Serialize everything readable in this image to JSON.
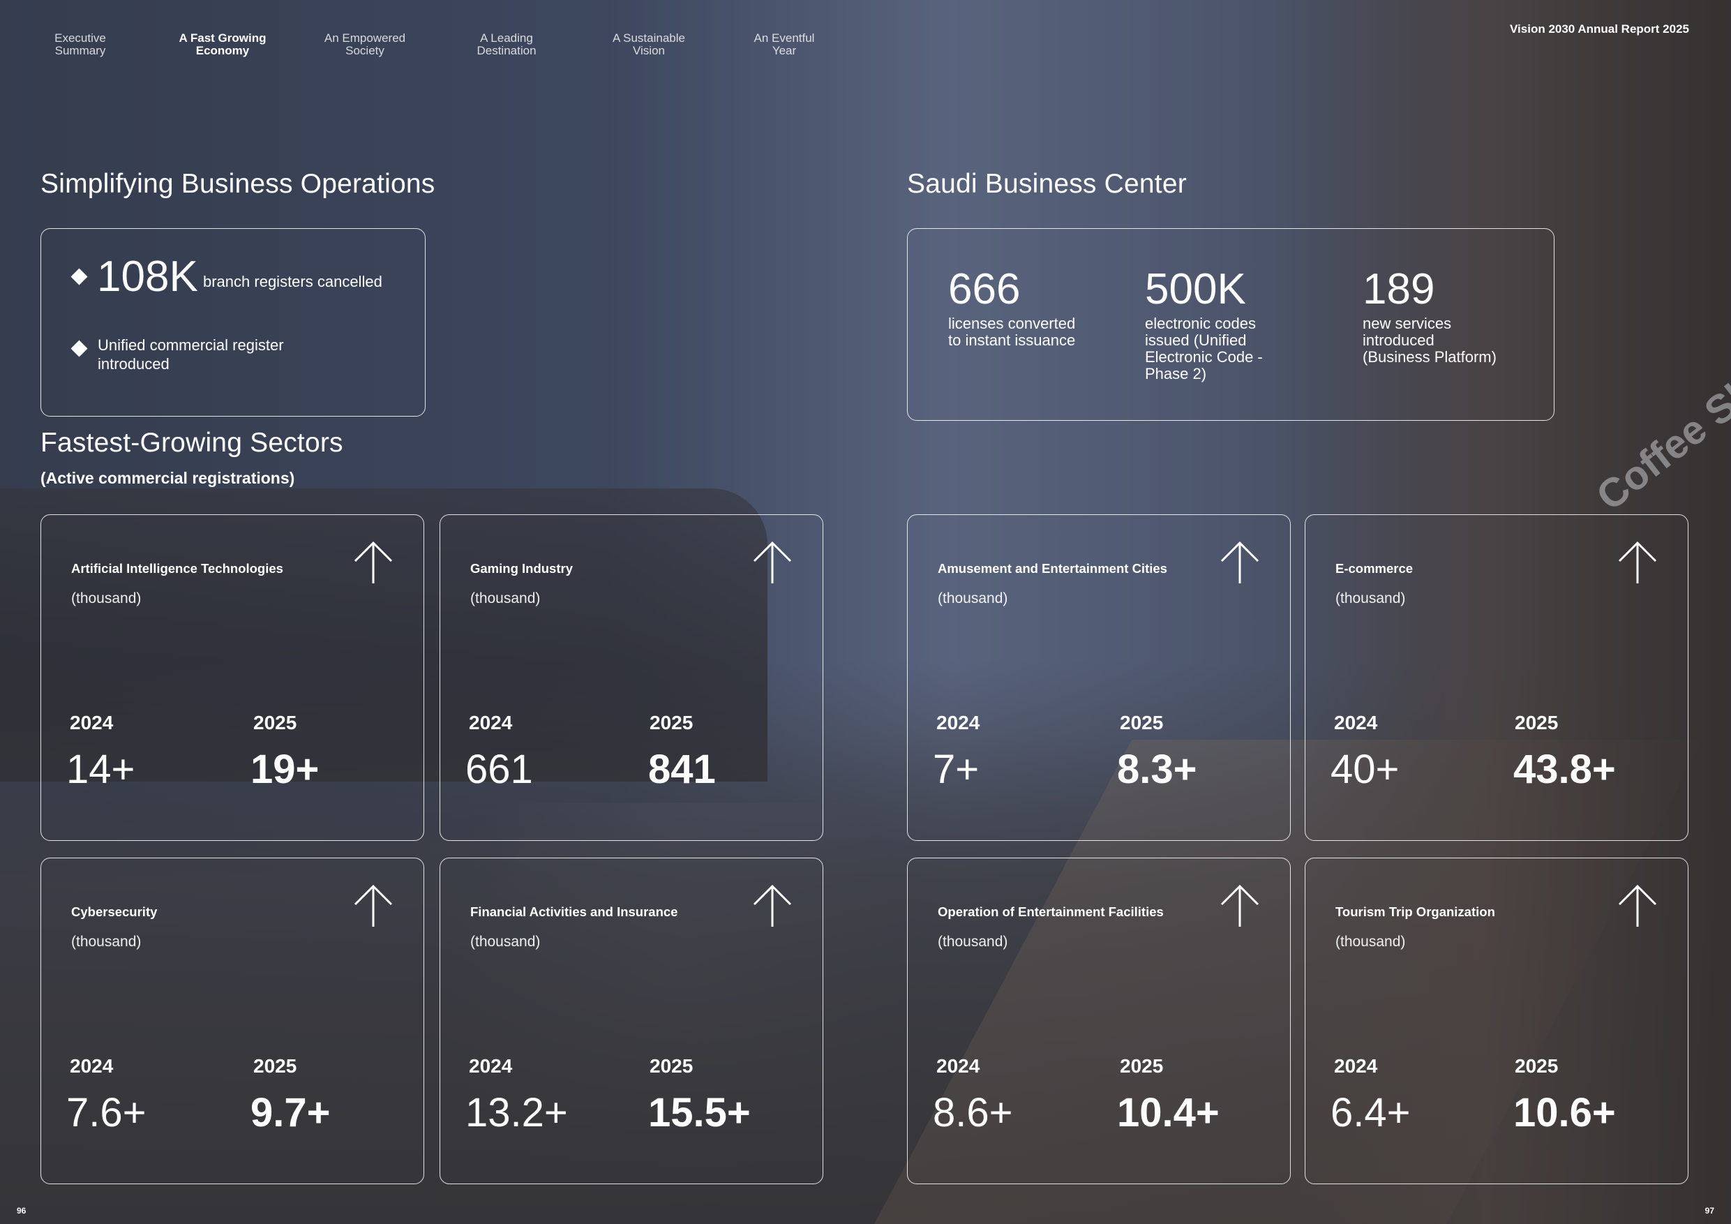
{
  "nav": [
    {
      "label_1": "Executive",
      "label_2": "Summary"
    },
    {
      "label_1": "A Fast Growing",
      "label_2": "Economy"
    },
    {
      "label_1": "An Empowered",
      "label_2": "Society"
    },
    {
      "label_1": "A Leading",
      "label_2": "Destination"
    },
    {
      "label_1": "A Sustainable",
      "label_2": "Vision"
    },
    {
      "label_1": "An Eventful",
      "label_2": "Year"
    }
  ],
  "report_title": "Vision 2030 Annual Report 2025",
  "background_sign": "Coffee Shop",
  "simplifying": {
    "heading": "Simplifying Business Operations",
    "value": "108K",
    "value_text": "branch registers cancelled",
    "item_line1": "Unified commercial register",
    "item_line2": "introduced"
  },
  "sbc": {
    "heading": "Saudi Business Center",
    "stats": [
      {
        "value": "666",
        "lines": [
          "licenses converted",
          "to instant issuance"
        ]
      },
      {
        "value": "500K",
        "lines": [
          "electronic codes",
          "issued (Unified",
          "Electronic Code -",
          "Phase 2)"
        ]
      },
      {
        "value": "189",
        "lines": [
          "new services",
          "introduced",
          "(Business Platform)"
        ]
      }
    ]
  },
  "sectors": {
    "heading": "Fastest-Growing Sectors",
    "subheading": "(Active commercial registrations)",
    "cards": [
      {
        "title": "Artificial Intelligence Technologies",
        "unit": "(thousand)",
        "year_a": "2024",
        "year_b": "2025",
        "value_a": "14+",
        "value_b": "19+"
      },
      {
        "title": "Gaming Industry",
        "unit": "(thousand)",
        "year_a": "2024",
        "year_b": "2025",
        "value_a": "661",
        "value_b": "841"
      },
      {
        "title": "Amusement and Entertainment Cities",
        "unit": "(thousand)",
        "year_a": "2024",
        "year_b": "2025",
        "value_a": "7+",
        "value_b": "8.3+"
      },
      {
        "title": "E-commerce",
        "unit": "(thousand)",
        "year_a": "2024",
        "year_b": "2025",
        "value_a": "40+",
        "value_b": "43.8+"
      },
      {
        "title": "Cybersecurity",
        "unit": "(thousand)",
        "year_a": "2024",
        "year_b": "2025",
        "value_a": "7.6+",
        "value_b": "9.7+"
      },
      {
        "title": "Financial Activities and Insurance",
        "unit": "(thousand)",
        "year_a": "2024",
        "year_b": "2025",
        "value_a": "13.2+",
        "value_b": "15.5+"
      },
      {
        "title": "Operation of Entertainment Facilities",
        "unit": "(thousand)",
        "year_a": "2024",
        "year_b": "2025",
        "value_a": "8.6+",
        "value_b": "10.4+"
      },
      {
        "title": "Tourism Trip Organization",
        "unit": "(thousand)",
        "year_a": "2024",
        "year_b": "2025",
        "value_a": "6.4+",
        "value_b": "10.6+"
      }
    ]
  },
  "page_numbers": {
    "left": "96",
    "right": "97"
  }
}
